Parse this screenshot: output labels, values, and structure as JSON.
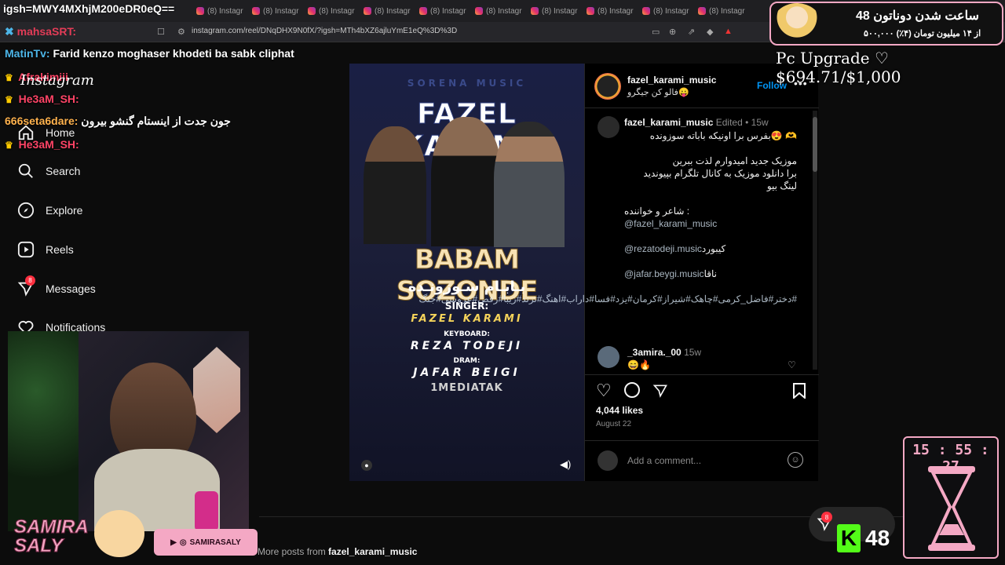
{
  "browser": {
    "tab_label": "(8) Instagr",
    "tab_count": 10,
    "url": "instagram.com/reel/DNqDHX9N0fX/?igsh=MTh4bXZ6ajluYmE1eQ%3D%3D"
  },
  "overlay_top": {
    "igsh_text": "igsh=MWY4MXhjM200eDR0eQ==",
    "mahsa_text": "mahsaSRT:"
  },
  "chat": [
    {
      "user": "MatinTv:",
      "message": "Farid kenzo moghaser khodeti ba sabk cliphat",
      "crown": false,
      "color": "u"
    },
    {
      "user": "Afrakimiii",
      "message": "Instagram",
      "crown": true,
      "color": "red"
    },
    {
      "user": "He3aM_SH:",
      "message": "",
      "crown": true,
      "color": "red"
    },
    {
      "user": "666seta6dare:",
      "message": "جون جدت از اینستام گنشو بیرون",
      "crown": false,
      "color": "org"
    },
    {
      "user": "He3aM_SH:",
      "message": "",
      "crown": true,
      "color": "red"
    }
  ],
  "nav": {
    "items": [
      {
        "label": "Home",
        "icon": "home-icon"
      },
      {
        "label": "Search",
        "icon": "search-icon"
      },
      {
        "label": "Explore",
        "icon": "compass-icon"
      },
      {
        "label": "Reels",
        "icon": "reels-icon"
      },
      {
        "label": "Messages",
        "icon": "messenger-icon",
        "badge": "8"
      },
      {
        "label": "Notifications",
        "icon": "heart-icon"
      }
    ]
  },
  "post": {
    "cover": {
      "watermark": "SORENA MUSIC",
      "title": "FAZEL KARAMI",
      "song": "BABAM SOZONDE",
      "song_fa": "بـابـام سـوزونـده",
      "singer_label": "SINGER:",
      "singer": "FAZEL KARAMI",
      "keyboard_label": "KEYBOARD:",
      "keyboard": "REZA TODEJI",
      "dram_label": "DRAM:",
      "dram": "JAFAR BEIGI",
      "brand": "1MEDIATAK"
    },
    "author": "fazel_karami_music",
    "author_sub": "فالو کن جیگرو😛",
    "follow_label": "Follow",
    "caption_meta": {
      "user": "fazel_karami_music",
      "edited": "Edited",
      "time": "15w"
    },
    "caption_lines": [
      "بفرس برا اونیکه باباته سوزونده😍 🫶",
      "",
      "موزیک جدید امیدوارم لذت ببرین",
      "برا دانلود موزیک به کانال تلگرام بپیوندید",
      "لینگ بیو",
      "",
      "شاعر و خواننده :"
    ],
    "links": [
      {
        "text": "@fazel_karami_music",
        "suffix": ""
      },
      {
        "text": "@rezatodeji.music",
        "suffix": "کیبورد"
      },
      {
        "text": "@jafar.beygi.music",
        "suffix": "ناقا"
      }
    ],
    "hashtags": "#دختر#فاضل_کرمی#چاهک#شیراز#کرمان#یزد#فسا#داراب#اهنگ#ترند#زیبا#رقص#عروسی#جنگ",
    "comment": {
      "user": "_3amira._00",
      "time": "15w",
      "text": "😄🔥"
    },
    "likes": "4,044 likes",
    "date": "August 22",
    "comment_placeholder": "Add a comment..."
  },
  "more_posts": {
    "prefix": "More posts from",
    "user": "fazel_karami_music"
  },
  "messages_float": {
    "badge": "8"
  },
  "donation": {
    "headline": "48 ساعت شدن دوناتون",
    "sub": "۵۰۰,۰۰۰ از ۱۴ میلیون تومان (۴٪)",
    "goal": "Pc Upgrade ♡ $694.71/$1,000"
  },
  "streamer": {
    "name_line1": "SAMIRA",
    "name_line2": "SALY",
    "social": "SAMIRASALY"
  },
  "timer": "15 : 55 : 27",
  "kick_count": "48",
  "colors": {
    "accent_blue": "#0095f6",
    "link": "#e0f1ff",
    "pink": "#f4a8c4",
    "kick": "#53fc18"
  }
}
